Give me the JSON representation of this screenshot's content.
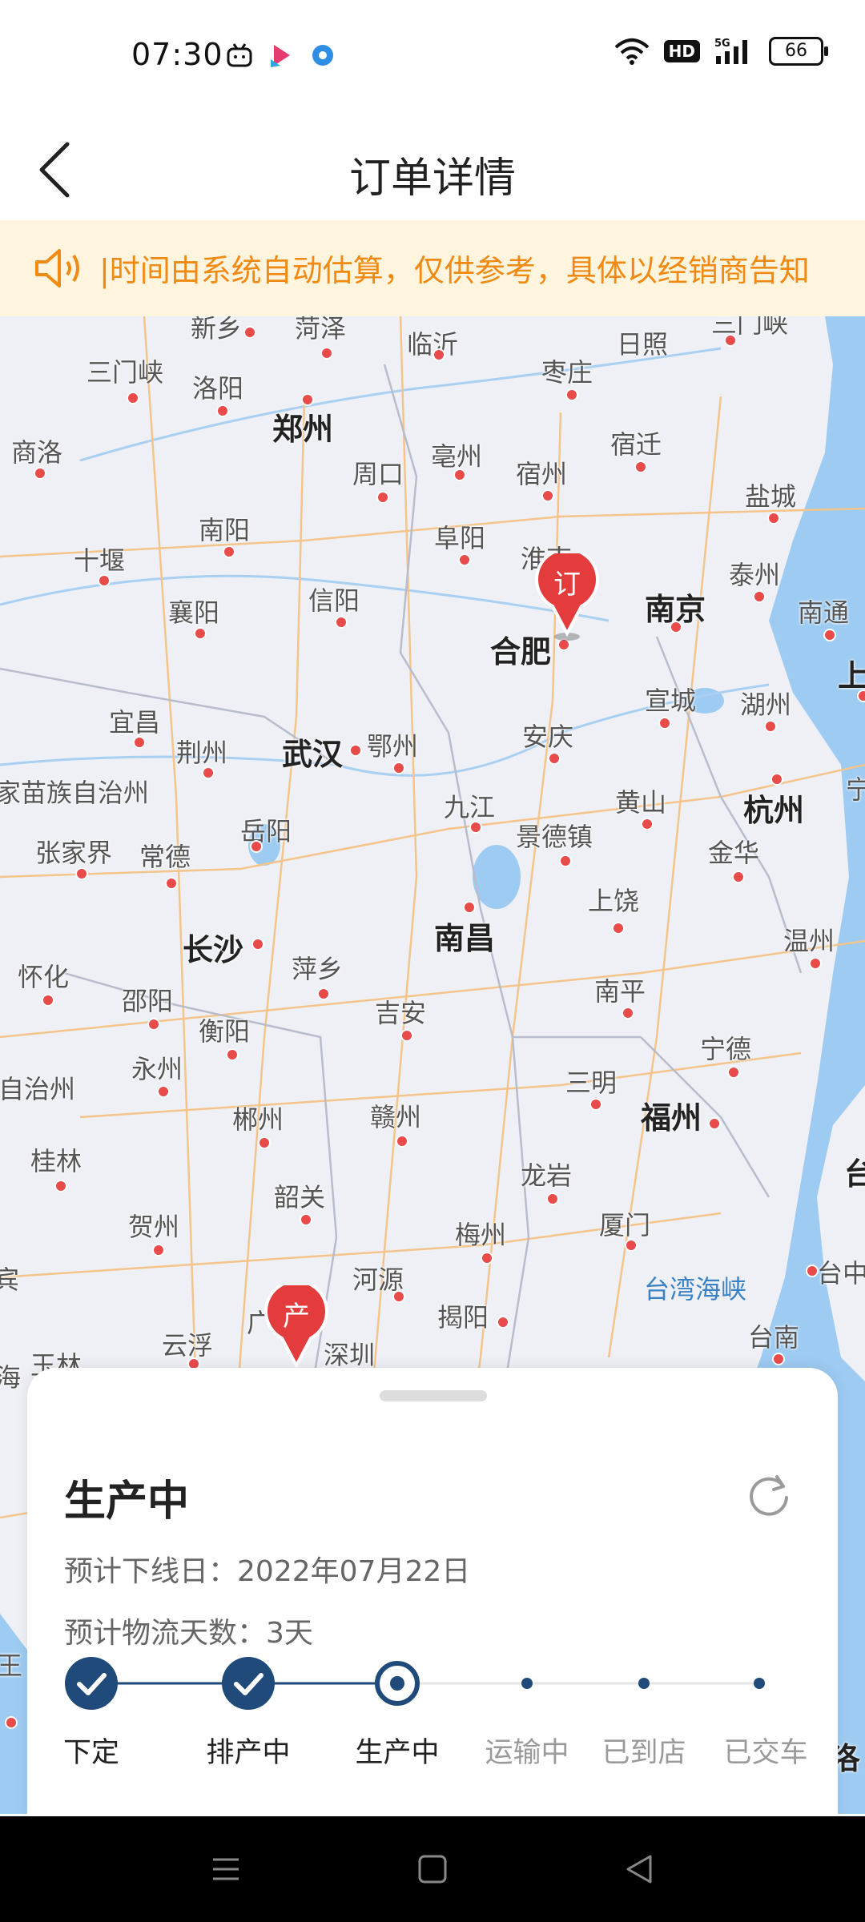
{
  "status_bar": {
    "time": "07:30",
    "network": "5G",
    "hd": "HD",
    "battery": "66"
  },
  "header": {
    "title": "订单详情"
  },
  "notice": {
    "text": "|时间由系统自动估算，仅供参考，具体以经销商告知"
  },
  "map": {
    "cities": [
      {
        "name": "新乡",
        "big": false
      },
      {
        "name": "菏泽",
        "big": false
      },
      {
        "name": "临沂",
        "big": false
      },
      {
        "name": "日照",
        "big": false
      },
      {
        "name": "三门峡",
        "big": false
      },
      {
        "name": "洛阳",
        "big": false
      },
      {
        "name": "郑州",
        "big": true
      },
      {
        "name": "枣庄",
        "big": false
      },
      {
        "name": "商洛",
        "big": false
      },
      {
        "name": "周口",
        "big": false
      },
      {
        "name": "亳州",
        "big": false
      },
      {
        "name": "宿州",
        "big": false
      },
      {
        "name": "宿迁",
        "big": false
      },
      {
        "name": "盐城",
        "big": false
      },
      {
        "name": "南阳",
        "big": false
      },
      {
        "name": "阜阳",
        "big": false
      },
      {
        "name": "淮南",
        "big": false
      },
      {
        "name": "泰州",
        "big": false
      },
      {
        "name": "十堰",
        "big": false
      },
      {
        "name": "襄阳",
        "big": false
      },
      {
        "name": "信阳",
        "big": false
      },
      {
        "name": "南京",
        "big": true
      },
      {
        "name": "南通",
        "big": false
      },
      {
        "name": "合肥",
        "big": true
      },
      {
        "name": "上",
        "big": false
      },
      {
        "name": "宜昌",
        "big": false
      },
      {
        "name": "宣城",
        "big": false
      },
      {
        "name": "湖州",
        "big": false
      },
      {
        "name": "荆州",
        "big": false
      },
      {
        "name": "武汉",
        "big": true
      },
      {
        "name": "鄂州",
        "big": false
      },
      {
        "name": "安庆",
        "big": false
      },
      {
        "name": "家苗族自治州",
        "big": false
      },
      {
        "name": "杭州",
        "big": true
      },
      {
        "name": "宁",
        "big": false
      },
      {
        "name": "九江",
        "big": false
      },
      {
        "name": "黄山",
        "big": false
      },
      {
        "name": "岳阳",
        "big": false
      },
      {
        "name": "景德镇",
        "big": false
      },
      {
        "name": "张家界",
        "big": false
      },
      {
        "name": "常德",
        "big": false
      },
      {
        "name": "金华",
        "big": false
      },
      {
        "name": "上饶",
        "big": false
      },
      {
        "name": "长沙",
        "big": true
      },
      {
        "name": "南昌",
        "big": true
      },
      {
        "name": "温州",
        "big": false
      },
      {
        "name": "萍乡",
        "big": false
      },
      {
        "name": "怀化",
        "big": false
      },
      {
        "name": "邵阳",
        "big": false
      },
      {
        "name": "吉安",
        "big": false
      },
      {
        "name": "南平",
        "big": false
      },
      {
        "name": "衡阳",
        "big": false
      },
      {
        "name": "宁德",
        "big": false
      },
      {
        "name": "永州",
        "big": false
      },
      {
        "name": "自治州",
        "big": false
      },
      {
        "name": "三明",
        "big": false
      },
      {
        "name": "郴州",
        "big": false
      },
      {
        "name": "赣州",
        "big": false
      },
      {
        "name": "福州",
        "big": true
      },
      {
        "name": "台",
        "big": false
      },
      {
        "name": "桂林",
        "big": false
      },
      {
        "name": "龙岩",
        "big": false
      },
      {
        "name": "韶关",
        "big": false
      },
      {
        "name": "贺州",
        "big": false
      },
      {
        "name": "梅州",
        "big": false
      },
      {
        "name": "厦门",
        "big": false
      },
      {
        "name": "台中",
        "big": false
      },
      {
        "name": "河源",
        "big": false
      },
      {
        "name": "宾",
        "big": false
      },
      {
        "name": "揭阳",
        "big": false
      },
      {
        "name": "台南",
        "big": false
      },
      {
        "name": "云浮",
        "big": false
      },
      {
        "name": "广",
        "big": false
      },
      {
        "name": "深圳",
        "big": false
      },
      {
        "name": "玉林",
        "big": false
      },
      {
        "name": "海",
        "big": false
      },
      {
        "name": "王",
        "big": false
      },
      {
        "name": "洛",
        "big": false
      }
    ],
    "sea_label": "台湾海峡",
    "pins": {
      "order": "订",
      "production": "产"
    }
  },
  "order_status": {
    "title": "生产中",
    "offline_date_label": "预计下线日：",
    "offline_date": "2022年07月22日",
    "logistics_label": "预计物流天数：",
    "logistics_days": "3天",
    "steps": [
      {
        "label": "下定",
        "state": "done"
      },
      {
        "label": "排产中",
        "state": "done"
      },
      {
        "label": "生产中",
        "state": "current"
      },
      {
        "label": "运输中",
        "state": "pending"
      },
      {
        "label": "已到店",
        "state": "pending"
      },
      {
        "label": "已交车",
        "state": "pending"
      }
    ]
  },
  "colors": {
    "accent": "#1F4A7A",
    "pin_red": "#E43C3C",
    "notice_text": "#F08A12",
    "notice_bg": "#FFF4DE"
  }
}
